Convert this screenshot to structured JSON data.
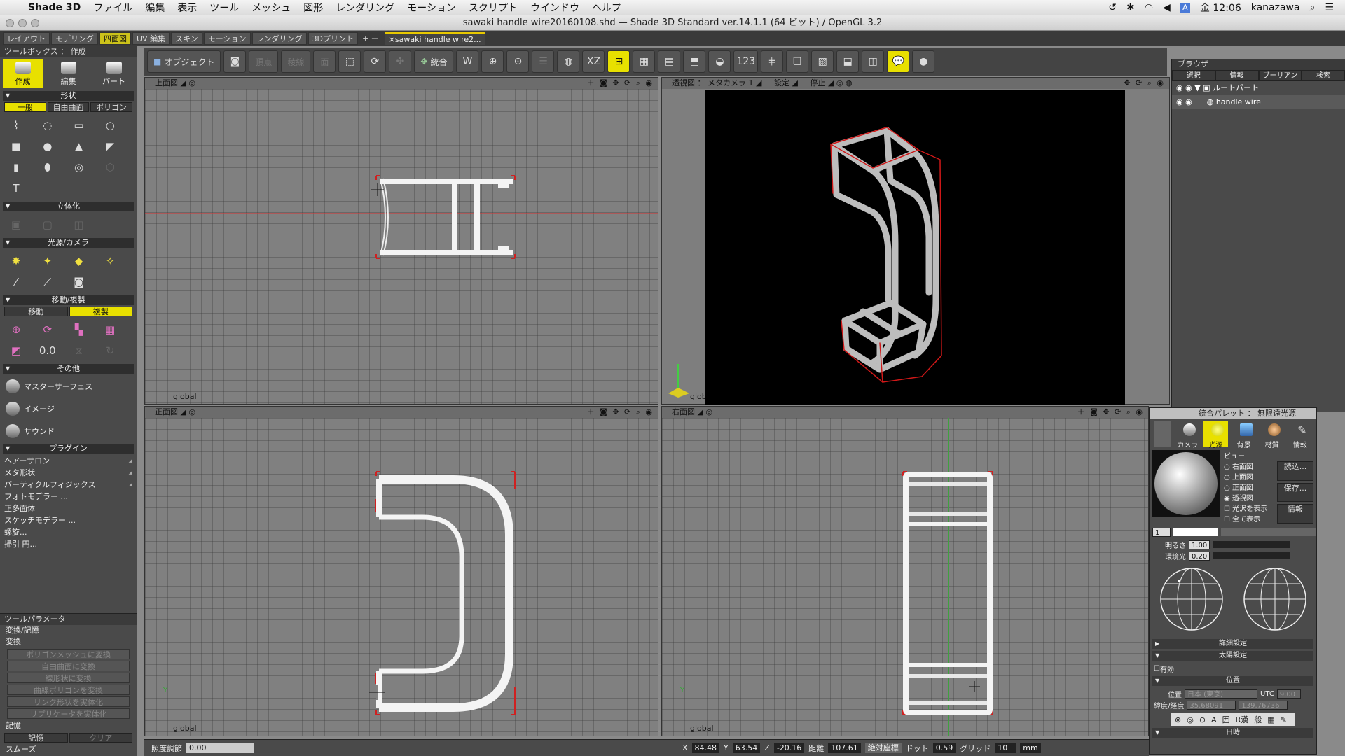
{
  "menubar": {
    "app": "Shade 3D",
    "items": [
      "ファイル",
      "編集",
      "表示",
      "ツール",
      "メッシュ",
      "図形",
      "レンダリング",
      "モーション",
      "スクリプト",
      "ウインドウ",
      "ヘルプ"
    ],
    "clock": "金 12:06",
    "user": "kanazawa",
    "status_icons": [
      "time-machine-icon",
      "bluetooth-icon",
      "wifi-icon",
      "volume-icon",
      "input-A-icon",
      "search-icon",
      "list-icon"
    ]
  },
  "window": {
    "title": "sawaki handle wire20160108.shd — Shade 3D Standard ver.14.1.1 (64 ビット) / OpenGL 3.2"
  },
  "tabs": {
    "items": [
      "レイアウト",
      "モデリング",
      "四面図",
      "UV 編集",
      "スキン",
      "モーション",
      "レンダリング",
      "3Dプリント"
    ],
    "active": "四面図",
    "add": "+ ー",
    "doc": "×sawaki handle wire2..."
  },
  "toolbox": {
    "title": "ツールボックス ： 作成",
    "big": [
      "作成",
      "編集",
      "パート"
    ],
    "sec_shape": "形状",
    "shape_tabs": [
      "一般",
      "自由曲面",
      "ポリゴン"
    ],
    "sec_solid": "立体化",
    "sec_light": "光源/カメラ",
    "sec_move": "移動/複製",
    "move_tabs": [
      "移動",
      "複製"
    ],
    "sec_other": "その他",
    "other": [
      "マスターサーフェス",
      "イメージ",
      "サウンド"
    ],
    "sec_plugin": "プラグイン",
    "plugins": [
      "ヘアーサロン",
      "メタ形状",
      "パーティクルフィジックス",
      "フォトモデラー ...",
      "正多面体",
      "スケッチモデラー ...",
      "螺旋...",
      "掃引 円..."
    ]
  },
  "toolparam": {
    "title": "ツールパラメータ",
    "sub": "変換/記憶",
    "conv": "変換",
    "buttons": [
      "ポリゴンメッシュに変換",
      "自由曲面に変換",
      "線形状に変換",
      "曲線ポリゴンを変換",
      "リンク形状を実体化",
      "リプリケータを実体化"
    ],
    "memory": "記憶",
    "mem_btns": [
      "記憶",
      "クリア"
    ],
    "smooth": "スムーズ"
  },
  "maintools": {
    "object": "オブジェクト",
    "vertex": "頂点",
    "edge": "稜線",
    "face": "面",
    "combine": "統合"
  },
  "viewports": {
    "top": "上面図",
    "persp": "透視図 ： メタカメラ 1",
    "persp_set": "設定",
    "persp_stop": "停止",
    "front": "正面図",
    "right": "右面図",
    "global": "global"
  },
  "browser": {
    "title": "ブラウザ",
    "tabs": [
      "選択",
      "情報",
      "ブーリアン",
      "検索"
    ],
    "root": "ルートパート",
    "item": "handle wire"
  },
  "palette": {
    "title": "統合パレット ： 無限遠光源",
    "tabs": [
      "カメラ",
      "光源",
      "背景",
      "材質",
      "情報"
    ],
    "view": "ビュー",
    "views": [
      "右面図",
      "上面図",
      "正面図",
      "透視図"
    ],
    "opts": [
      "光沢を表示",
      "全て表示"
    ],
    "btns": [
      "読込...",
      "保存...",
      "情報"
    ],
    "num": "1",
    "brightness_label": "明るさ",
    "brightness": "1.00",
    "ambient_label": "環境光",
    "ambient": "0.20",
    "detail": "詳細設定",
    "sun": "太陽設定",
    "enabled": "有効",
    "position": "位置",
    "pos_label": "位置",
    "pos_val": "日本 (東京)",
    "utc": "UTC",
    "utc_val": "9.00",
    "latlon": "緯度/経度",
    "lat": "35.68091",
    "lon": "139.76736",
    "date": "日時"
  },
  "status": {
    "brightness_label": "照度調節",
    "brightness": "0.00",
    "x_label": "X",
    "x": "84.48",
    "y_label": "Y",
    "y": "63.54",
    "z_label": "Z",
    "z": "-20.16",
    "dist_label": "距離",
    "dist": "107.61",
    "coord": "絶対座標",
    "dot_label": "ドット",
    "dot": "0.59",
    "grid_label": "グリッド",
    "grid": "10",
    "unit": "mm"
  }
}
